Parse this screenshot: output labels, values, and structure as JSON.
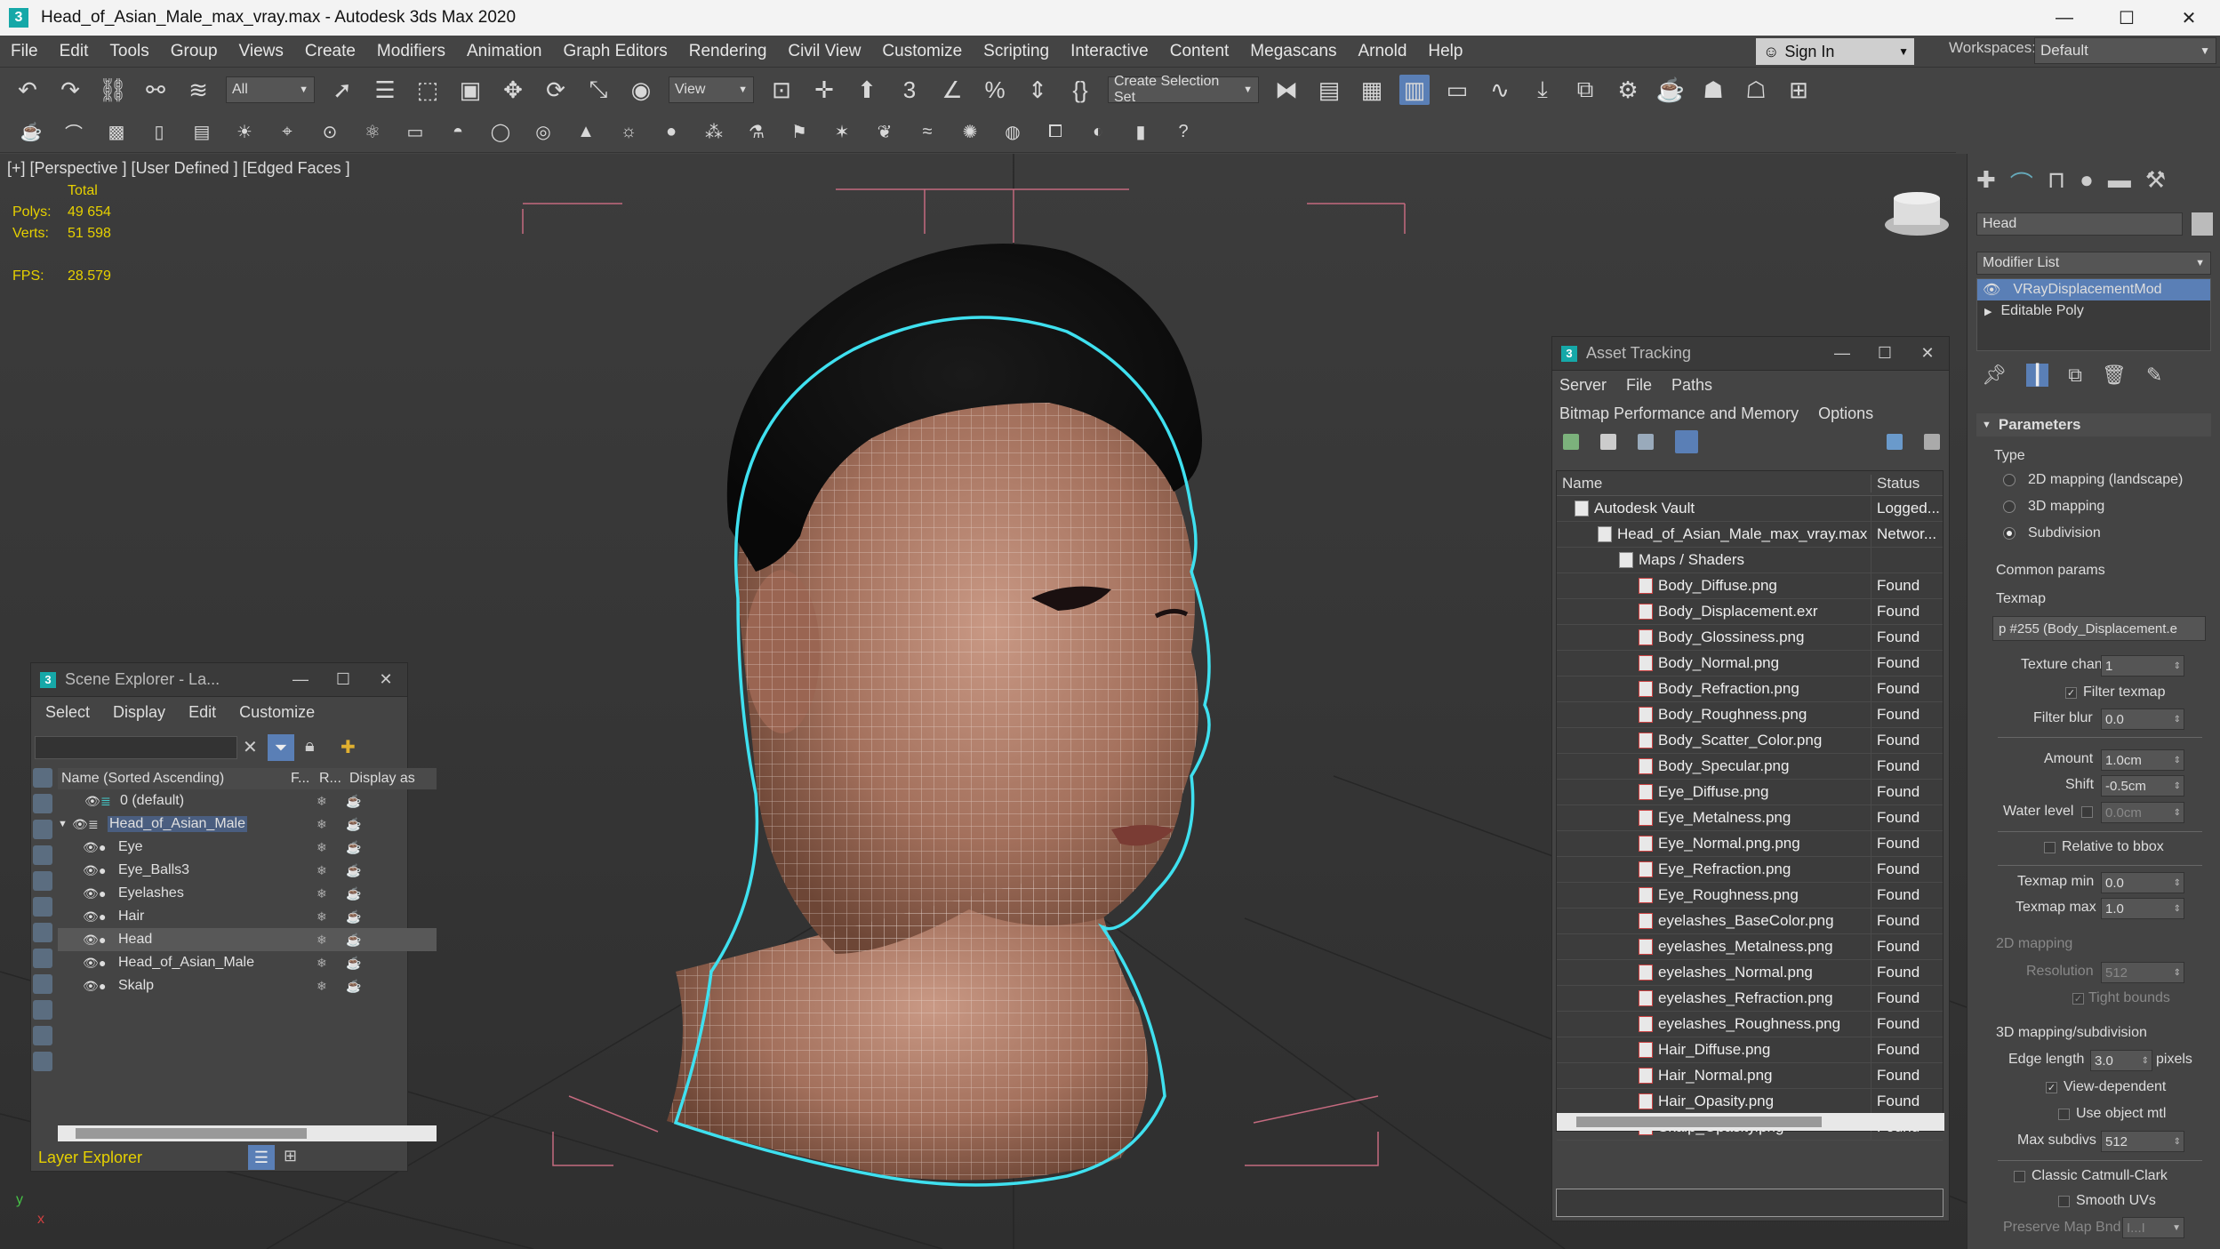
{
  "app": {
    "title": "Head_of_Asian_Male_max_vray.max - Autodesk 3ds Max 2020",
    "icon_label": "3",
    "win_min": "—",
    "win_max": "☐",
    "win_close": "✕"
  },
  "menu": [
    "File",
    "Edit",
    "Tools",
    "Group",
    "Views",
    "Create",
    "Modifiers",
    "Animation",
    "Graph Editors",
    "Rendering",
    "Civil View",
    "Customize",
    "Scripting",
    "Interactive",
    "Content",
    "Megascans",
    "Arnold",
    "Help"
  ],
  "signin": {
    "label": "Sign In"
  },
  "workspaces": {
    "label": "Workspaces:",
    "value": "Default"
  },
  "toolbar": {
    "selection_filter": "All",
    "ref_coord": "View",
    "selection_set": "Create Selection Set"
  },
  "viewport": {
    "label": "[+] [Perspective ] [User Defined ] [Edged Faces ]",
    "stats_header": "Total",
    "polys_label": "Polys:",
    "polys_value": "49 654",
    "verts_label": "Verts:",
    "verts_value": "51 598",
    "fps_label": "FPS:",
    "fps_value": "28.579",
    "axis_y": "y",
    "axis_x": "x"
  },
  "scene_explorer": {
    "title": "Scene Explorer - La...",
    "menu": [
      "Select",
      "Display",
      "Edit",
      "Customize"
    ],
    "col_name": "Name (Sorted Ascending)",
    "col_f": "F...",
    "col_r": "R...",
    "col_display": "Display as",
    "rows": [
      {
        "name": "0 (default)",
        "indent": 0
      },
      {
        "name": "Head_of_Asian_Male",
        "indent": 1
      },
      {
        "name": "Eye",
        "indent": 2
      },
      {
        "name": "Eye_Balls3",
        "indent": 2
      },
      {
        "name": "Eyelashes",
        "indent": 2
      },
      {
        "name": "Hair",
        "indent": 2
      },
      {
        "name": "Head",
        "indent": 2
      },
      {
        "name": "Head_of_Asian_Male",
        "indent": 2
      },
      {
        "name": "Skalp",
        "indent": 2
      }
    ],
    "footer": "Layer Explorer"
  },
  "asset_tracking": {
    "title": "Asset Tracking",
    "menu1": [
      "Server",
      "File",
      "Paths"
    ],
    "menu2": [
      "Bitmap Performance and Memory",
      "Options"
    ],
    "col_name": "Name",
    "col_status": "Status",
    "rows": [
      {
        "name": "Autodesk Vault",
        "status": "Logged...",
        "level": 0
      },
      {
        "name": "Head_of_Asian_Male_max_vray.max",
        "status": "Networ...",
        "level": 1
      },
      {
        "name": "Maps / Shaders",
        "status": "",
        "level": 2
      },
      {
        "name": "Body_Diffuse.png",
        "status": "Found",
        "level": 3
      },
      {
        "name": "Body_Displacement.exr",
        "status": "Found",
        "level": 3
      },
      {
        "name": "Body_Glossiness.png",
        "status": "Found",
        "level": 3
      },
      {
        "name": "Body_Normal.png",
        "status": "Found",
        "level": 3
      },
      {
        "name": "Body_Refraction.png",
        "status": "Found",
        "level": 3
      },
      {
        "name": "Body_Roughness.png",
        "status": "Found",
        "level": 3
      },
      {
        "name": "Body_Scatter_Color.png",
        "status": "Found",
        "level": 3
      },
      {
        "name": "Body_Specular.png",
        "status": "Found",
        "level": 3
      },
      {
        "name": "Eye_Diffuse.png",
        "status": "Found",
        "level": 3
      },
      {
        "name": "Eye_Metalness.png",
        "status": "Found",
        "level": 3
      },
      {
        "name": "Eye_Normal.png.png",
        "status": "Found",
        "level": 3
      },
      {
        "name": "Eye_Refraction.png",
        "status": "Found",
        "level": 3
      },
      {
        "name": "Eye_Roughness.png",
        "status": "Found",
        "level": 3
      },
      {
        "name": "eyelashes_BaseColor.png",
        "status": "Found",
        "level": 3
      },
      {
        "name": "eyelashes_Metalness.png",
        "status": "Found",
        "level": 3
      },
      {
        "name": "eyelashes_Normal.png",
        "status": "Found",
        "level": 3
      },
      {
        "name": "eyelashes_Refraction.png",
        "status": "Found",
        "level": 3
      },
      {
        "name": "eyelashes_Roughness.png",
        "status": "Found",
        "level": 3
      },
      {
        "name": "Hair_Diffuse.png",
        "status": "Found",
        "level": 3
      },
      {
        "name": "Hair_Normal.png",
        "status": "Found",
        "level": 3
      },
      {
        "name": "Hair_Opasity.png",
        "status": "Found",
        "level": 3
      },
      {
        "name": "Skalp_Opasity.png",
        "status": "Found",
        "level": 3
      }
    ]
  },
  "command_panel": {
    "object_name": "Head",
    "modifier_list": "Modifier List",
    "stack": [
      "VRayDisplacementMod",
      "Editable Poly"
    ],
    "rollout": "Parameters",
    "type_label": "Type",
    "type_options": [
      "2D mapping (landscape)",
      "3D mapping",
      "Subdivision"
    ],
    "common_params": "Common params",
    "texmap_label": "Texmap",
    "texmap_value": "p #255 (Body_Displacement.e",
    "texture_chan_label": "Texture chan",
    "texture_chan_value": "1",
    "filter_texmap": "Filter texmap",
    "filter_blur_label": "Filter blur",
    "filter_blur_value": "0.0",
    "amount_label": "Amount",
    "amount_value": "1.0cm",
    "shift_label": "Shift",
    "shift_value": "-0.5cm",
    "water_level_label": "Water level",
    "water_level_value": "0.0cm",
    "relative_bbox": "Relative to bbox",
    "texmap_min_label": "Texmap min",
    "texmap_min_value": "0.0",
    "texmap_max_label": "Texmap max",
    "texmap_max_value": "1.0",
    "mapping2d": "2D mapping",
    "resolution_label": "Resolution",
    "resolution_value": "512",
    "tight_bounds": "Tight bounds",
    "mapping3d": "3D mapping/subdivision",
    "edge_length_label": "Edge length",
    "edge_length_value": "3.0",
    "edge_length_unit": "pixels",
    "view_dependent": "View-dependent",
    "use_object_mtl": "Use object mtl",
    "max_subdivs_label": "Max subdivs",
    "max_subdivs_value": "512",
    "classic_catmull": "Classic Catmull-Clark",
    "smooth_uvs": "Smooth UVs",
    "preserve_map": "Preserve Map Bnd",
    "preserve_value": "I...I"
  }
}
